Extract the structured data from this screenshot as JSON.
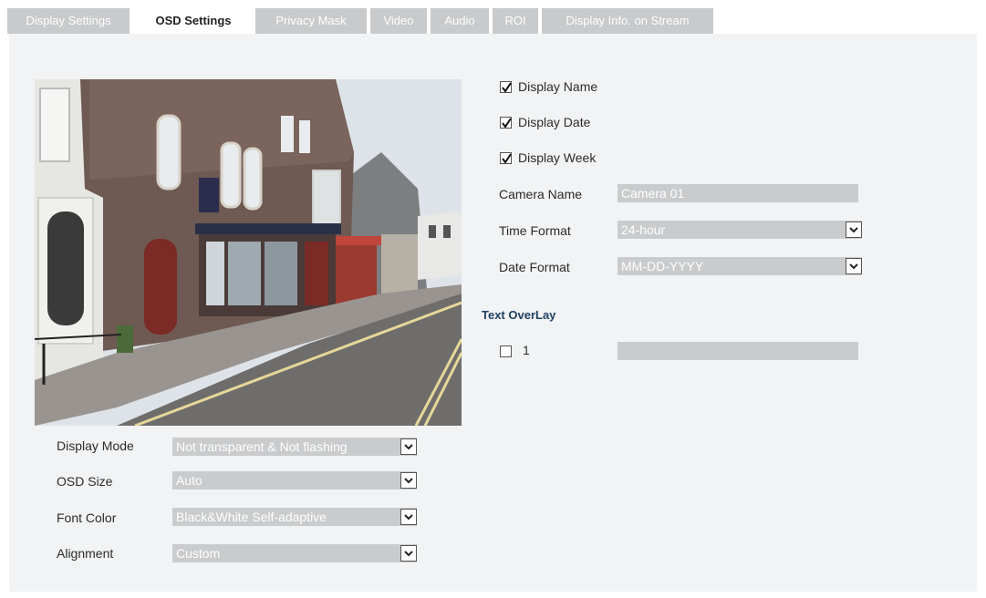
{
  "tabs": [
    {
      "label": "Display Settings",
      "active": false
    },
    {
      "label": "OSD Settings",
      "active": true
    },
    {
      "label": "Privacy Mask",
      "active": false
    },
    {
      "label": "Video",
      "active": false
    },
    {
      "label": "Audio",
      "active": false
    },
    {
      "label": "ROI",
      "active": false
    },
    {
      "label": "Display Info. on Stream",
      "active": false
    }
  ],
  "checkboxes": {
    "display_name": {
      "label": "Display Name",
      "checked": true
    },
    "display_date": {
      "label": "Display Date",
      "checked": true
    },
    "display_week": {
      "label": "Display Week",
      "checked": true
    }
  },
  "camera_name": {
    "label": "Camera Name",
    "value": "Camera 01"
  },
  "time_format": {
    "label": "Time Format",
    "value": "24-hour"
  },
  "date_format": {
    "label": "Date Format",
    "value": "MM-DD-YYYY"
  },
  "text_overlay": {
    "title": "Text OverLay",
    "items": [
      {
        "label": "1",
        "checked": false,
        "value": ""
      }
    ]
  },
  "display_mode": {
    "label": "Display Mode",
    "value": "Not transparent & Not flashing"
  },
  "osd_size": {
    "label": "OSD Size",
    "value": "Auto"
  },
  "font_color": {
    "label": "Font Color",
    "value": "Black&White Self-adaptive"
  },
  "alignment": {
    "label": "Alignment",
    "value": "Custom"
  },
  "colors": {
    "panel": "#f2f3f4",
    "tab_inactive": "#c8cacc",
    "field": "#c9cbcd",
    "section_title": "#1f3f63"
  }
}
